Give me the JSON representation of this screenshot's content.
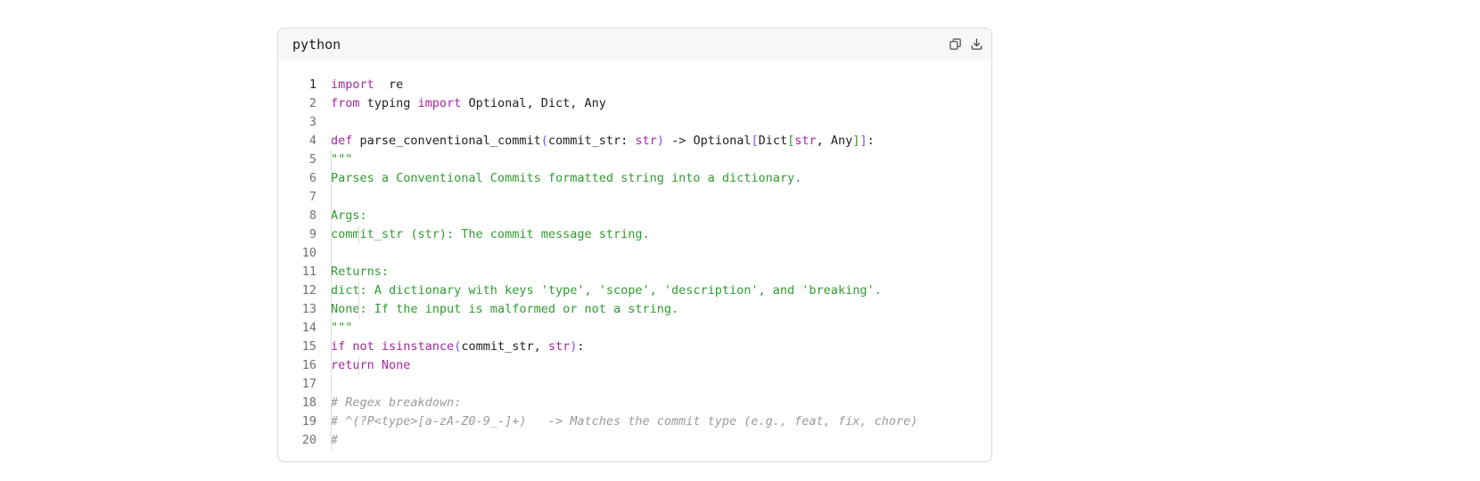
{
  "code_block": {
    "language": "python",
    "actions": {
      "copy_icon": "copy-icon",
      "download_icon": "download-icon"
    },
    "lines": [
      {
        "n": "1",
        "tokens": [
          [
            "kw",
            "import"
          ],
          [
            "",
            "  re"
          ]
        ]
      },
      {
        "n": "2",
        "tokens": [
          [
            "kw",
            "from"
          ],
          [
            "",
            " typing "
          ],
          [
            "kw",
            "import"
          ],
          [
            "",
            " Optional, Dict, Any"
          ]
        ]
      },
      {
        "n": "3",
        "tokens": []
      },
      {
        "n": "4",
        "tokens": [
          [
            "kw",
            "def"
          ],
          [
            "fnm",
            " parse_conventional_commit"
          ],
          [
            "br1",
            "("
          ],
          [
            "",
            "commit_str: "
          ],
          [
            "bi",
            "str"
          ],
          [
            "br1",
            ")"
          ],
          [
            "",
            " -> Optional"
          ],
          [
            "br1",
            "["
          ],
          [
            "",
            "Dict"
          ],
          [
            "br2",
            "["
          ],
          [
            "bi",
            "str"
          ],
          [
            "",
            ", Any"
          ],
          [
            "br2",
            "]"
          ],
          [
            "br1",
            "]"
          ],
          [
            "",
            ":"
          ]
        ]
      },
      {
        "n": "5",
        "indent": 1,
        "tokens": [
          [
            "str",
            "\"\"\""
          ]
        ]
      },
      {
        "n": "6",
        "indent": 1,
        "tokens": [
          [
            "str",
            "Parses a Conventional Commits formatted string into a dictionary."
          ]
        ]
      },
      {
        "n": "7",
        "indent": 0,
        "tokens": []
      },
      {
        "n": "8",
        "indent": 1,
        "tokens": [
          [
            "str",
            "Args:"
          ]
        ]
      },
      {
        "n": "9",
        "indent": 2,
        "tokens": [
          [
            "str",
            "commit_str (str): The commit message string."
          ]
        ]
      },
      {
        "n": "10",
        "indent": 0,
        "tokens": []
      },
      {
        "n": "11",
        "indent": 1,
        "tokens": [
          [
            "str",
            "Returns:"
          ]
        ]
      },
      {
        "n": "12",
        "indent": 2,
        "tokens": [
          [
            "str",
            "dict: A dictionary with keys 'type', 'scope', 'description', and 'breaking'."
          ]
        ]
      },
      {
        "n": "13",
        "indent": 2,
        "tokens": [
          [
            "str",
            "None: If the input is malformed or not a string."
          ]
        ]
      },
      {
        "n": "14",
        "indent": 1,
        "tokens": [
          [
            "str",
            "\"\"\""
          ]
        ]
      },
      {
        "n": "15",
        "indent": 1,
        "tokens": [
          [
            "kw",
            "if not "
          ],
          [
            "kw",
            "isinstance"
          ],
          [
            "br1",
            "("
          ],
          [
            "",
            "commit_str, "
          ],
          [
            "bi",
            "str"
          ],
          [
            "br1",
            ")"
          ],
          [
            "",
            ":"
          ]
        ]
      },
      {
        "n": "16",
        "indent": 2,
        "tokens": [
          [
            "kw",
            "return None"
          ]
        ]
      },
      {
        "n": "17",
        "indent": 0,
        "tokens": []
      },
      {
        "n": "18",
        "indent": 1,
        "tokens": [
          [
            "cm",
            "# Regex breakdown:"
          ]
        ]
      },
      {
        "n": "19",
        "indent": 1,
        "tokens": [
          [
            "cm",
            "# ^(?P<type>[a-zA-Z0-9_-]+)   -> Matches the commit type (e.g., feat, fix, chore)"
          ]
        ]
      },
      {
        "n": "20",
        "indent": 1,
        "tokens": [
          [
            "cm",
            "#"
          ]
        ]
      }
    ],
    "active_line": "1"
  }
}
